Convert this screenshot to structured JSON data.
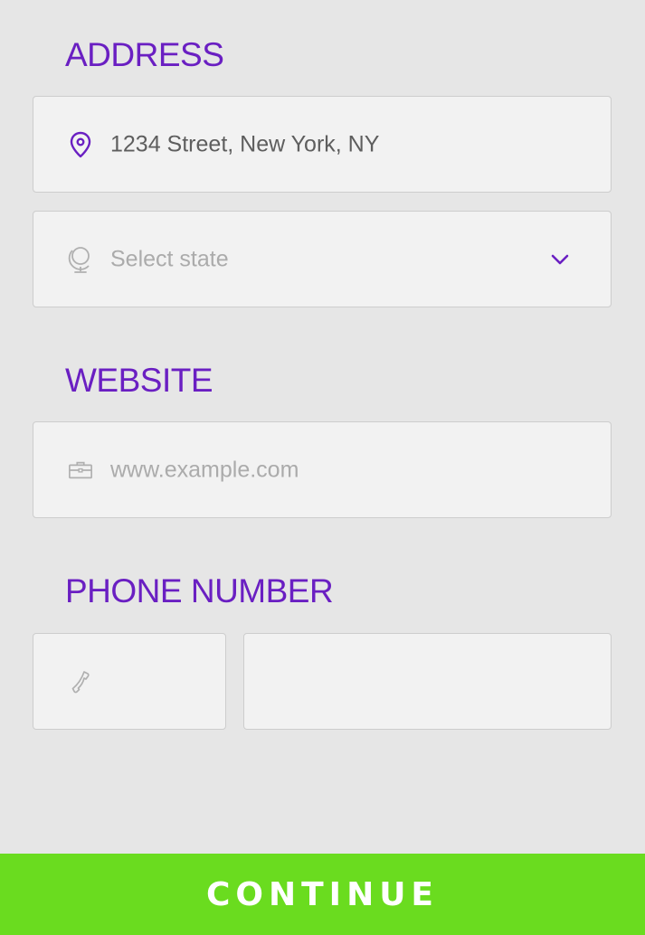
{
  "address": {
    "title": "ADDRESS",
    "street": {
      "value": "1234 Street, New York, NY",
      "icon": "location-pin-icon"
    },
    "state": {
      "placeholder": "Select state",
      "icon": "globe-icon",
      "dropdown_icon": "chevron-down-icon"
    }
  },
  "website": {
    "title": "WEBSITE",
    "url": {
      "placeholder": "www.example.com",
      "icon": "briefcase-icon"
    }
  },
  "phone": {
    "title": "PHONE NUMBER",
    "code": {
      "value": "",
      "icon": "phone-icon"
    },
    "number": {
      "value": ""
    }
  },
  "actions": {
    "continue_label": "CONTINUE"
  },
  "colors": {
    "background": "#e6e6e6",
    "field_background": "#f2f2f2",
    "field_border": "#cdcdcd",
    "accent": "#6a1fc2",
    "button": "#6adc1f"
  }
}
